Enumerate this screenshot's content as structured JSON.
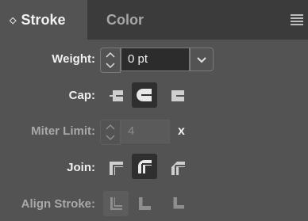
{
  "tabs": {
    "stroke_label": "Stroke",
    "color_label": "Color"
  },
  "weight": {
    "label": "Weight:",
    "value": "0 pt"
  },
  "cap": {
    "label": "Cap:",
    "selected": "round"
  },
  "miter": {
    "label": "Miter Limit:",
    "value": "4",
    "unit": "x"
  },
  "join": {
    "label": "Join:",
    "selected": "round"
  },
  "align": {
    "label": "Align Stroke:"
  }
}
